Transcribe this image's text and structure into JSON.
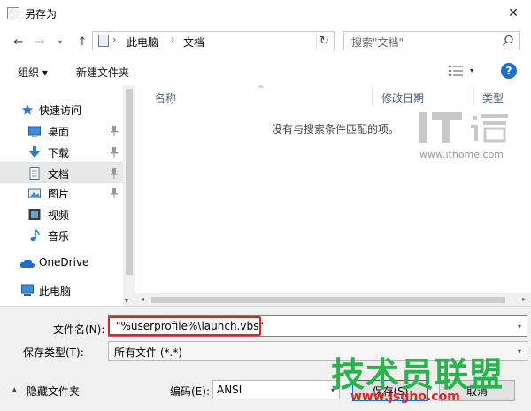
{
  "window": {
    "title": "另存为",
    "close_glyph": "✕"
  },
  "nav": {
    "back_glyph": "←",
    "forward_glyph": "→",
    "recent_glyph": "▾",
    "up_glyph": "↑",
    "path": [
      "此电脑",
      "文档"
    ],
    "separator": "›",
    "dropdown_glyph": "▾",
    "refresh_glyph": "↻",
    "search_placeholder": "搜索\"文档\""
  },
  "toolbar": {
    "organize": "组织 ▾",
    "new_folder": "新建文件夹",
    "view_dropdown": "▾",
    "help": "?"
  },
  "sidebar": {
    "items": [
      {
        "label": "快速访问",
        "icon": "star-icon",
        "pinned": false
      },
      {
        "label": "桌面",
        "icon": "desktop-icon",
        "pinned": true
      },
      {
        "label": "下载",
        "icon": "download-icon",
        "pinned": true
      },
      {
        "label": "文档",
        "icon": "document-icon",
        "pinned": true,
        "selected": true
      },
      {
        "label": "图片",
        "icon": "picture-icon",
        "pinned": true
      },
      {
        "label": "视频",
        "icon": "video-icon",
        "pinned": false
      },
      {
        "label": "音乐",
        "icon": "music-icon",
        "pinned": false
      },
      {
        "label": "OneDrive",
        "icon": "cloud-icon",
        "pinned": false
      },
      {
        "label": "此电脑",
        "icon": "computer-icon",
        "pinned": false
      }
    ],
    "pin_glyph": "📌",
    "scroll_down": "▾"
  },
  "content": {
    "columns": [
      "名称",
      "修改日期",
      "类型"
    ],
    "sort_glyph": "^",
    "empty_message": "没有与搜索条件匹配的项。",
    "scroll_left": "◂",
    "scroll_right": "▸"
  },
  "form": {
    "filename_label": "文件名(N):",
    "filename_value": "\"%userprofile%\\launch.vbs\"",
    "filetype_label": "保存类型(T):",
    "filetype_value": "所有文件  (*.*)",
    "dropdown_glyph": "▾",
    "hide_folders_glyph": "▴",
    "hide_folders": "隐藏文件夹",
    "encoding_label": "编码(E):",
    "encoding_value": "ANSI",
    "save": "保存(S)",
    "cancel": "取消"
  },
  "watermarks": {
    "ithome_url": "www.ithome.com",
    "jsgho_title": "技术员联盟",
    "jsgho_url": "www.jsgho.com"
  },
  "colors": {
    "accent": "#0078d7",
    "selection": "#e8e8e8",
    "highlight_box": "#d8232a",
    "watermark_green": "#27b44a",
    "watermark_red": "#e0262a"
  }
}
